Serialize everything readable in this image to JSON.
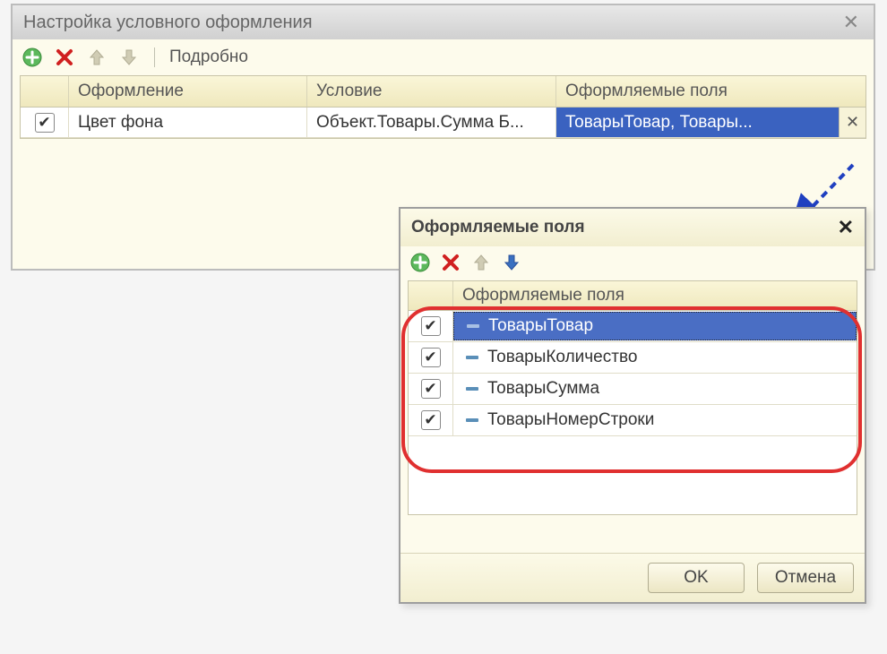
{
  "mainWindow": {
    "title": "Настройка условного оформления",
    "toolbar": {
      "detailLabel": "Подробно"
    },
    "columns": {
      "col1": "Оформление",
      "col2": "Условие",
      "col3": "Оформляемые поля"
    },
    "row": {
      "checked": true,
      "col1": "Цвет фона",
      "col2": "Объект.Товары.Сумма Б...",
      "col3": "ТоварыТовар, Товары..."
    }
  },
  "popup": {
    "title": "Оформляемые поля",
    "header": "Оформляемые поля",
    "items": [
      {
        "label": "ТоварыТовар",
        "checked": true,
        "selected": true
      },
      {
        "label": "ТоварыКоличество",
        "checked": true,
        "selected": false
      },
      {
        "label": "ТоварыСумма",
        "checked": true,
        "selected": false
      },
      {
        "label": "ТоварыНомерСтроки",
        "checked": true,
        "selected": false
      }
    ],
    "buttons": {
      "ok": "OK",
      "cancel": "Отмена"
    }
  }
}
